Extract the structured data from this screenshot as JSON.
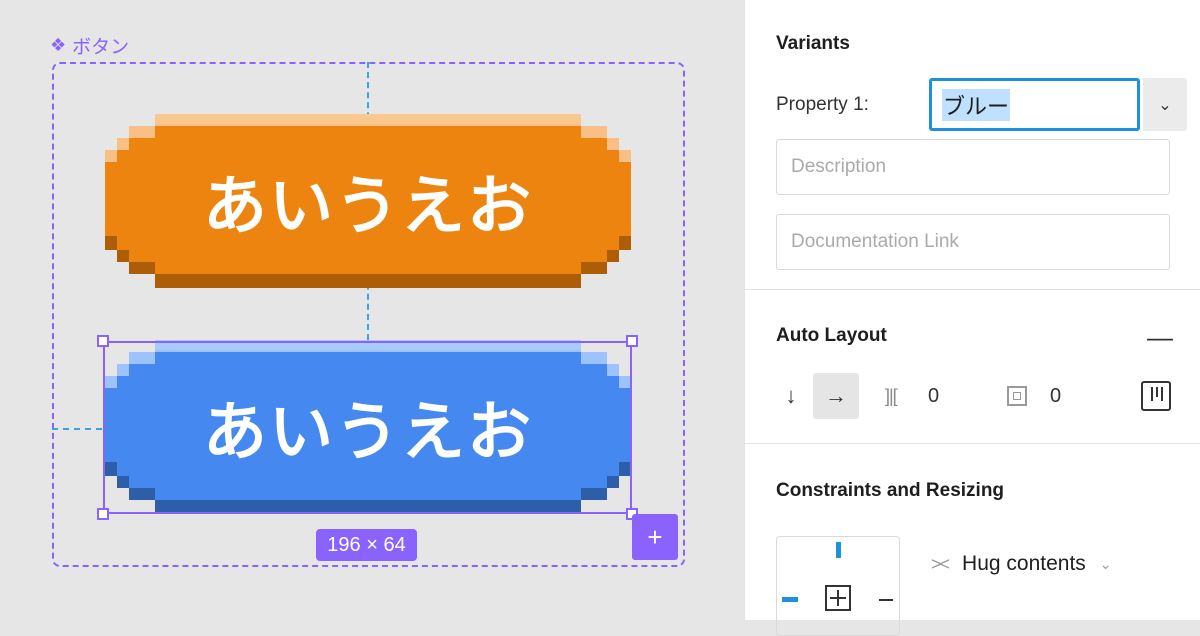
{
  "canvas": {
    "component_name": "ボタン",
    "component_icon": "component-diamond-icon",
    "buttons": [
      {
        "label": "あいうえお",
        "color": "#ee8410",
        "variant": "orange"
      },
      {
        "label": "あいうえお",
        "color": "#4488f0",
        "variant": "blue"
      }
    ],
    "dimensions": "196 × 64",
    "add_icon": "+"
  },
  "panel": {
    "variants": {
      "title": "Variants",
      "property_label": "Property 1:",
      "property_value": "ブルー",
      "description_placeholder": "Description",
      "doc_link_placeholder": "Documentation Link"
    },
    "auto_layout": {
      "title": "Auto Layout",
      "remove_icon": "—",
      "direction_vertical": "↓",
      "direction_horizontal": "→",
      "spacing": "0",
      "padding": "0",
      "selected_direction": "horizontal"
    },
    "constraints": {
      "title": "Constraints and Resizing",
      "resize_mode": "Hug contents"
    }
  },
  "colors": {
    "selection": "#8a63ff",
    "guide": "#3aa3e3",
    "focus": "#1f8fe0"
  }
}
